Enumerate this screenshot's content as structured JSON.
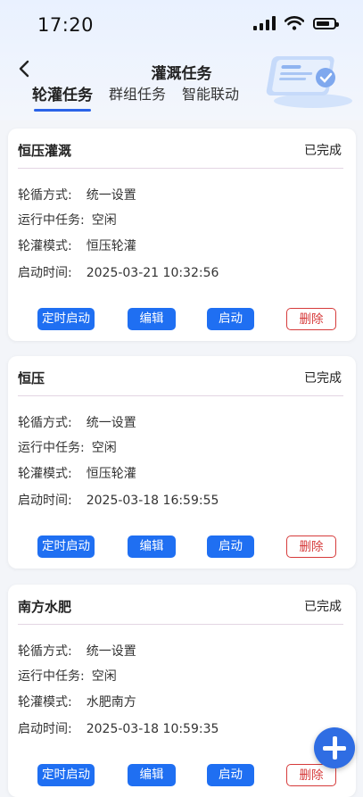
{
  "status_bar": {
    "time": "17:20"
  },
  "header": {
    "title": "灌溉任务",
    "tabs": [
      {
        "label": "轮灌任务",
        "active": true
      },
      {
        "label": "群组任务",
        "active": false
      },
      {
        "label": "智能联动",
        "active": false
      }
    ]
  },
  "labels": {
    "mode": "轮循方式:",
    "running": "运行中任务:",
    "irrigation_mode": "轮灌模式:",
    "start_time": "启动时间:"
  },
  "buttons": {
    "timed_start": "定时启动",
    "edit": "编辑",
    "start": "启动",
    "delete": "删除"
  },
  "tasks": [
    {
      "name": "恒压灌溉",
      "status": "已完成",
      "mode": "统一设置",
      "running": "空闲",
      "irrigation_mode": "恒压轮灌",
      "start_time": "2025-03-21 10:32:56"
    },
    {
      "name": "恒压",
      "status": "已完成",
      "mode": "统一设置",
      "running": "空闲",
      "irrigation_mode": "恒压轮灌",
      "start_time": "2025-03-18 16:59:55"
    },
    {
      "name": "南方水肥",
      "status": "已完成",
      "mode": "统一设置",
      "running": "空闲",
      "irrigation_mode": "水肥南方",
      "start_time": "2025-03-18 10:59:35"
    }
  ],
  "colors": {
    "accent": "#1f6ff2",
    "danger": "#d63b3b"
  },
  "icons": {
    "fab": "plus-icon",
    "back": "back-arrow-icon"
  }
}
